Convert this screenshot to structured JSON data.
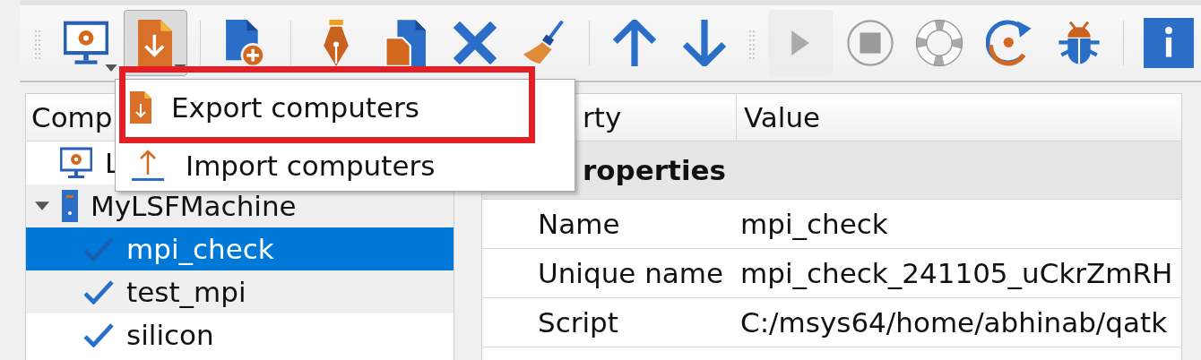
{
  "toolbar": {
    "groups": [
      {
        "kind": "grip",
        "buttons": [
          {
            "kind": "computer",
            "dropdown": true,
            "pressed": false,
            "disabled": false
          },
          {
            "kind": "export",
            "dropdown": true,
            "pressed": true,
            "disabled": false
          }
        ]
      },
      {
        "kind": "separator",
        "buttons": [
          {
            "kind": "new-file",
            "dropdown": false,
            "pressed": false,
            "disabled": false
          }
        ]
      },
      {
        "kind": "separator",
        "buttons": [
          {
            "kind": "pen",
            "dropdown": false,
            "pressed": false,
            "disabled": false
          },
          {
            "kind": "copy",
            "dropdown": false,
            "pressed": false,
            "disabled": false
          },
          {
            "kind": "delete",
            "dropdown": false,
            "pressed": false,
            "disabled": false
          },
          {
            "kind": "broom",
            "dropdown": false,
            "pressed": false,
            "disabled": false
          }
        ]
      },
      {
        "kind": "separator",
        "buttons": [
          {
            "kind": "up",
            "dropdown": false,
            "pressed": false,
            "disabled": false
          },
          {
            "kind": "down",
            "dropdown": false,
            "pressed": false,
            "disabled": false
          }
        ]
      },
      {
        "kind": "grip",
        "buttons": [
          {
            "kind": "play",
            "dropdown": false,
            "pressed": false,
            "disabled": true
          },
          {
            "kind": "stop",
            "dropdown": false,
            "pressed": false,
            "disabled": false
          },
          {
            "kind": "lifebuoy",
            "dropdown": false,
            "pressed": false,
            "disabled": false
          },
          {
            "kind": "refresh",
            "dropdown": false,
            "pressed": false,
            "disabled": false
          },
          {
            "kind": "bug",
            "dropdown": false,
            "pressed": false,
            "disabled": false
          }
        ]
      },
      {
        "kind": "separator",
        "buttons": [
          {
            "kind": "info",
            "dropdown": false,
            "pressed": false,
            "disabled": false
          }
        ]
      }
    ]
  },
  "menu": {
    "items": [
      {
        "kind": "export",
        "label": "Export computers",
        "framed": true
      },
      {
        "kind": "import",
        "label": "Import computers",
        "framed": false
      }
    ]
  },
  "tree": {
    "header": "Comp",
    "items": [
      {
        "kind": "computer",
        "label": "L",
        "selected": false
      },
      {
        "kind": "server",
        "label": "MyLSFMachine",
        "selected": false,
        "expanded": true,
        "children": [
          {
            "kind": "job",
            "label": "mpi_check",
            "selected": true
          },
          {
            "kind": "job",
            "label": "test_mpi",
            "selected": false
          },
          {
            "kind": "job",
            "label": "silicon",
            "selected": false
          }
        ]
      }
    ]
  },
  "properties": {
    "columns": [
      "rty",
      "Value"
    ],
    "group": "roperties",
    "rows": [
      {
        "name": "Name",
        "value": "mpi_check"
      },
      {
        "name": "Unique name",
        "value": "mpi_check_241105_uCkrZmRH"
      },
      {
        "name": "Script",
        "value": "C:/msys64/home/abhinab/qatk"
      }
    ]
  }
}
